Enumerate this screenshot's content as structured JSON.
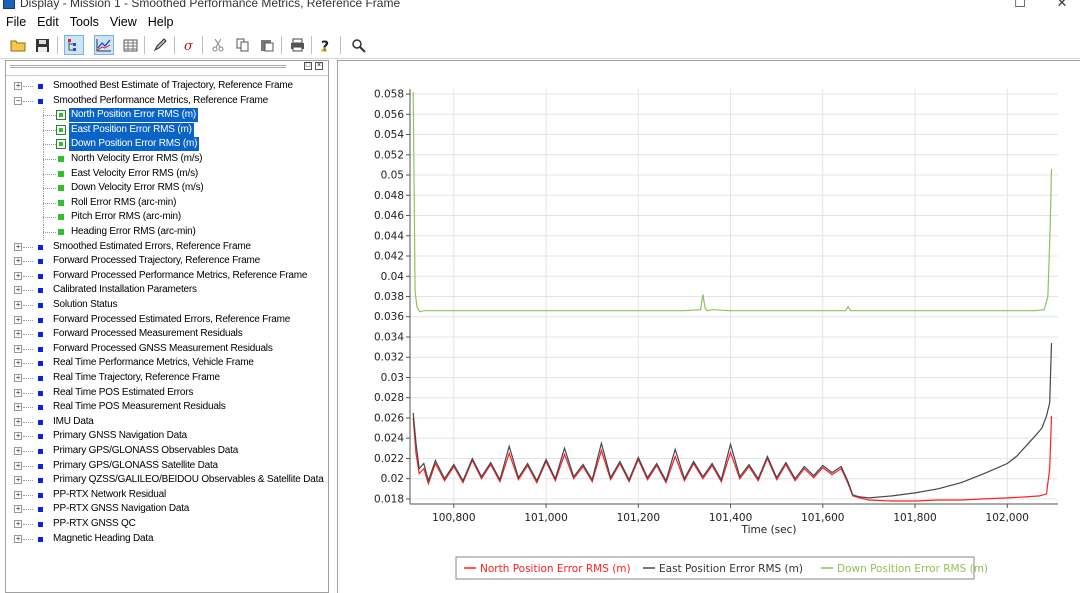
{
  "window": {
    "title": "Display - Mission 1 - Smoothed Performance Metrics, Reference Frame",
    "controls": {
      "minimize": "☐",
      "close": "✕"
    }
  },
  "menu": [
    "File",
    "Edit",
    "Tools",
    "View",
    "Help"
  ],
  "toolbar": {
    "buttons": [
      "open-folder",
      "save",
      "tree-view",
      "chart-view",
      "table-view",
      "pencil",
      "sigma",
      "cut",
      "copy",
      "paste",
      "print",
      "help",
      "zoom"
    ]
  },
  "panel": {
    "buttons": [
      "□",
      "×"
    ]
  },
  "tree": [
    {
      "label": "Smoothed Best Estimate of Trajectory, Reference Frame",
      "expander": "+"
    },
    {
      "label": "Smoothed Performance Metrics, Reference Frame",
      "expander": "−",
      "children": [
        {
          "label": "North Position Error RMS (m)",
          "selected": true
        },
        {
          "label": "East Position Error RMS (m)",
          "selected": true
        },
        {
          "label": "Down Position Error RMS (m)",
          "selected": true
        },
        {
          "label": "North Velocity Error RMS (m/s)",
          "selected": false
        },
        {
          "label": "East Velocity Error RMS (m/s)",
          "selected": false
        },
        {
          "label": "Down Velocity Error RMS (m/s)",
          "selected": false
        },
        {
          "label": "Roll Error RMS (arc-min)",
          "selected": false
        },
        {
          "label": "Pitch Error RMS (arc-min)",
          "selected": false
        },
        {
          "label": "Heading Error RMS (arc-min)",
          "selected": false
        }
      ]
    },
    {
      "label": "Smoothed Estimated Errors, Reference Frame",
      "expander": "+"
    },
    {
      "label": "Forward Processed Trajectory, Reference Frame",
      "expander": "+"
    },
    {
      "label": "Forward Processed Performance Metrics, Reference Frame",
      "expander": "+"
    },
    {
      "label": "Calibrated Installation Parameters",
      "expander": "+"
    },
    {
      "label": "Solution Status",
      "expander": "+"
    },
    {
      "label": "Forward Processed Estimated Errors, Reference Frame",
      "expander": "+"
    },
    {
      "label": "Forward Processed Measurement Residuals",
      "expander": "+"
    },
    {
      "label": "Forward Processed GNSS Measurement Residuals",
      "expander": "+"
    },
    {
      "label": "Real Time Performance Metrics, Vehicle Frame",
      "expander": "+"
    },
    {
      "label": "Real Time Trajectory, Reference Frame",
      "expander": "+"
    },
    {
      "label": "Real Time POS Estimated Errors",
      "expander": "+"
    },
    {
      "label": "Real Time POS Measurement Residuals",
      "expander": "+"
    },
    {
      "label": "IMU Data",
      "expander": "+"
    },
    {
      "label": "Primary GNSS Navigation Data",
      "expander": "+"
    },
    {
      "label": "Primary GPS/GLONASS Observables Data",
      "expander": "+"
    },
    {
      "label": "Primary GPS/GLONASS Satellite Data",
      "expander": "+"
    },
    {
      "label": "Primary QZSS/GALILEO/BEIDOU Observables & Satellite Data",
      "expander": "+"
    },
    {
      "label": "PP-RTX Network Residual",
      "expander": "+"
    },
    {
      "label": "PP-RTX GNSS Navigation Data",
      "expander": "+"
    },
    {
      "label": "PP-RTX GNSS QC",
      "expander": "+"
    },
    {
      "label": "Magnetic Heading Data",
      "expander": "+"
    }
  ],
  "chart_data": {
    "type": "line",
    "title": "",
    "xlabel": "Time (sec)",
    "ylabel": "",
    "xlim": [
      100705,
      102110
    ],
    "ylim": [
      0.0175,
      0.0585
    ],
    "xticks": [
      100800,
      101000,
      101200,
      101400,
      101600,
      101800,
      102000
    ],
    "xtick_labels": [
      "100,800",
      "101,000",
      "101,200",
      "101,400",
      "101,600",
      "101,800",
      "102,000"
    ],
    "yticks": [
      0.018,
      0.02,
      0.022,
      0.024,
      0.026,
      0.028,
      0.03,
      0.032,
      0.034,
      0.036,
      0.038,
      0.04,
      0.042,
      0.044,
      0.046,
      0.048,
      0.05,
      0.052,
      0.054,
      0.056,
      0.058
    ],
    "ytick_labels": [
      "0.018",
      "0.02",
      "0.022",
      "0.024",
      "0.026",
      "0.028",
      "0.03",
      "0.032",
      "0.034",
      "0.036",
      "0.038",
      "0.04",
      "0.042",
      "0.044",
      "0.046",
      "0.048",
      "0.05",
      "0.052",
      "0.054",
      "0.056",
      "0.058"
    ],
    "grid": true,
    "legend_position": "bottom",
    "series": [
      {
        "name": "North Position Error RMS (m)",
        "color": "#ff2020",
        "x": [
          100712,
          100718,
          100725,
          100735,
          100745,
          100760,
          100780,
          100800,
          100820,
          100840,
          100860,
          100880,
          100900,
          100920,
          100940,
          100960,
          100980,
          101000,
          101020,
          101040,
          101060,
          101080,
          101100,
          101120,
          101140,
          101160,
          101180,
          101200,
          101220,
          101240,
          101260,
          101280,
          101300,
          101320,
          101340,
          101360,
          101380,
          101400,
          101420,
          101440,
          101460,
          101480,
          101500,
          101520,
          101540,
          101560,
          101580,
          101600,
          101620,
          101640,
          101655,
          101665,
          101680,
          101700,
          101750,
          101800,
          101850,
          101900,
          101950,
          102000,
          102040,
          102070,
          102085,
          102092,
          102096
        ],
        "y": [
          0.026,
          0.0225,
          0.0205,
          0.021,
          0.0195,
          0.0215,
          0.0198,
          0.0212,
          0.0196,
          0.0218,
          0.02,
          0.0214,
          0.0197,
          0.0225,
          0.0199,
          0.0213,
          0.0196,
          0.0217,
          0.0198,
          0.0224,
          0.02,
          0.0212,
          0.0197,
          0.0228,
          0.0199,
          0.0215,
          0.0197,
          0.0219,
          0.0199,
          0.0213,
          0.0196,
          0.0222,
          0.0198,
          0.0215,
          0.02,
          0.0213,
          0.0197,
          0.0226,
          0.02,
          0.0212,
          0.0198,
          0.022,
          0.0199,
          0.0214,
          0.0198,
          0.021,
          0.0201,
          0.0211,
          0.0204,
          0.021,
          0.0195,
          0.0183,
          0.0181,
          0.0179,
          0.0178,
          0.0178,
          0.0179,
          0.0179,
          0.018,
          0.0181,
          0.0182,
          0.0183,
          0.0185,
          0.021,
          0.0262
        ]
      },
      {
        "name": "East Position Error RMS (m)",
        "color": "#3f4a4f",
        "x": [
          100712,
          100718,
          100725,
          100735,
          100745,
          100760,
          100780,
          100800,
          100820,
          100840,
          100860,
          100880,
          100900,
          100920,
          100940,
          100960,
          100980,
          101000,
          101020,
          101040,
          101060,
          101080,
          101100,
          101120,
          101140,
          101160,
          101180,
          101200,
          101220,
          101240,
          101260,
          101280,
          101300,
          101320,
          101340,
          101360,
          101380,
          101400,
          101420,
          101440,
          101460,
          101480,
          101500,
          101520,
          101540,
          101560,
          101580,
          101600,
          101620,
          101640,
          101655,
          101665,
          101680,
          101700,
          101750,
          101800,
          101850,
          101900,
          101950,
          102000,
          102020,
          102040,
          102060,
          102075,
          102085,
          102092,
          102096
        ],
        "y": [
          0.0265,
          0.0235,
          0.021,
          0.0215,
          0.0198,
          0.0218,
          0.02,
          0.0214,
          0.0198,
          0.022,
          0.0202,
          0.0216,
          0.0199,
          0.0232,
          0.0201,
          0.0215,
          0.0198,
          0.0219,
          0.02,
          0.023,
          0.0202,
          0.0214,
          0.0199,
          0.0235,
          0.0201,
          0.0217,
          0.0199,
          0.0221,
          0.0201,
          0.0215,
          0.0198,
          0.0229,
          0.02,
          0.0217,
          0.0202,
          0.0215,
          0.0199,
          0.0234,
          0.0202,
          0.0214,
          0.02,
          0.0222,
          0.0201,
          0.0216,
          0.02,
          0.0212,
          0.0203,
          0.0213,
          0.0206,
          0.0212,
          0.0197,
          0.0184,
          0.0182,
          0.0181,
          0.0183,
          0.0186,
          0.019,
          0.0196,
          0.0205,
          0.0215,
          0.0222,
          0.0232,
          0.0242,
          0.025,
          0.0262,
          0.0275,
          0.0334
        ]
      },
      {
        "name": "Down Position Error RMS (m)",
        "color": "#8fc35a",
        "x": [
          100712,
          100716,
          100720,
          100726,
          100735,
          100760,
          100800,
          100900,
          101000,
          101100,
          101200,
          101300,
          101335,
          101340,
          101345,
          101350,
          101360,
          101400,
          101500,
          101600,
          101650,
          101655,
          101660,
          101700,
          101800,
          101900,
          102000,
          102060,
          102080,
          102088,
          102093,
          102096
        ],
        "y": [
          0.0582,
          0.0385,
          0.037,
          0.0365,
          0.0366,
          0.0366,
          0.0366,
          0.0366,
          0.0366,
          0.0366,
          0.0366,
          0.0366,
          0.0367,
          0.0382,
          0.0368,
          0.0366,
          0.0367,
          0.0366,
          0.0366,
          0.0366,
          0.0366,
          0.037,
          0.0366,
          0.0366,
          0.0366,
          0.0366,
          0.0366,
          0.0366,
          0.0367,
          0.038,
          0.045,
          0.0506
        ]
      }
    ]
  }
}
